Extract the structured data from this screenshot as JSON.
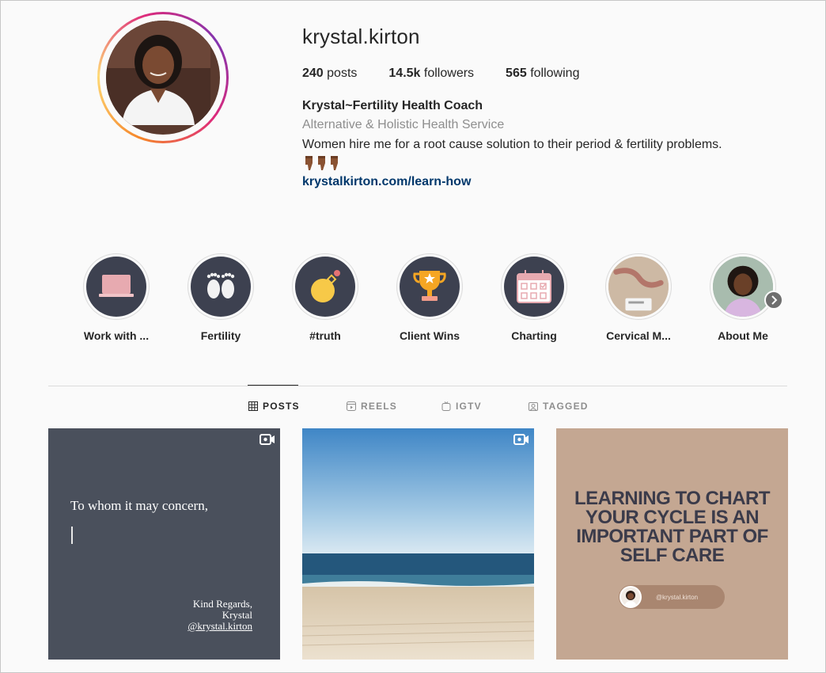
{
  "profile": {
    "username": "krystal.kirton",
    "stats": [
      {
        "value": "240",
        "label": "posts"
      },
      {
        "value": "14.5k",
        "label": "followers"
      },
      {
        "value": "565",
        "label": "following"
      }
    ],
    "full_name": "Krystal~Fertility Health Coach",
    "category": "Alternative & Holistic Health Service",
    "bio": "Women hire me for a root cause solution to their period & fertility problems.",
    "bio_emoji": "👇🏾👇🏾👇🏾",
    "website": "krystalkirton.com/learn-how"
  },
  "highlights": [
    {
      "label": "Work with ...",
      "icon": "laptop-icon"
    },
    {
      "label": "Fertility",
      "icon": "baby-feet-icon"
    },
    {
      "label": "#truth",
      "icon": "bomb-icon"
    },
    {
      "label": "Client Wins",
      "icon": "trophy-icon"
    },
    {
      "label": "Charting",
      "icon": "calendar-icon"
    },
    {
      "label": "Cervical M...",
      "icon": "photo-thumbnail"
    },
    {
      "label": "About Me",
      "icon": "portrait-thumbnail"
    }
  ],
  "tabs": [
    {
      "label": "POSTS",
      "icon": "grid-icon",
      "active": true
    },
    {
      "label": "REELS",
      "icon": "reels-icon",
      "active": false
    },
    {
      "label": "IGTV",
      "icon": "igtv-icon",
      "active": false
    },
    {
      "label": "TAGGED",
      "icon": "tagged-icon",
      "active": false
    }
  ],
  "posts": [
    {
      "type": "video",
      "title": "To whom it may concern,",
      "sign_lines": [
        "Kind Regards,",
        "Krystal",
        "@krystal.kirton"
      ]
    },
    {
      "type": "video",
      "scene": "beach"
    },
    {
      "type": "image",
      "headline_lines": [
        "LEARNING TO CHART",
        "YOUR CYCLE IS AN",
        "IMPORTANT PART OF",
        "SELF CARE"
      ],
      "handle": "@krystal.kirton"
    }
  ],
  "colors": {
    "link": "#00376b",
    "secondary_text": "#8e8e8e",
    "highlight_bg": "#3d4150",
    "post3_bg": "#c4a792"
  }
}
